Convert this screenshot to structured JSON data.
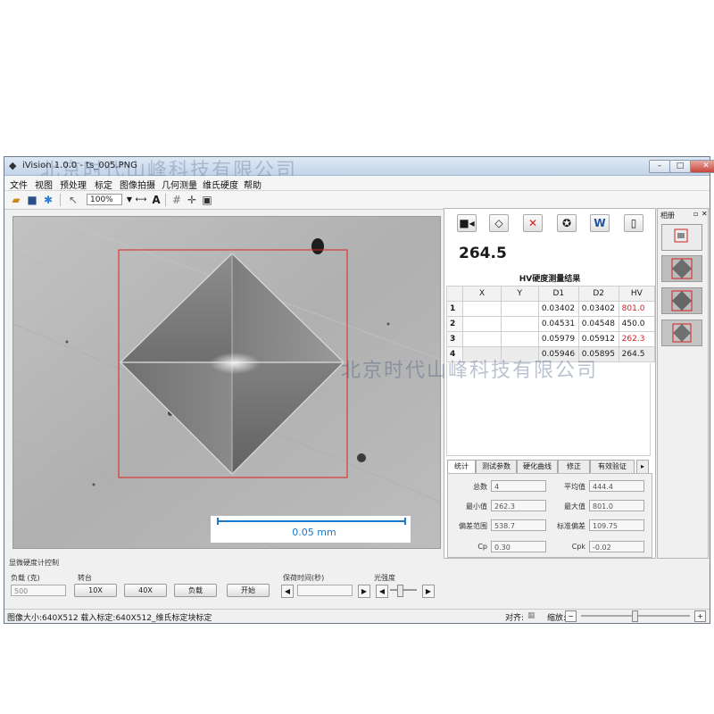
{
  "window": {
    "title": "iVision 1.0.0 - ts_005.PNG"
  },
  "watermark": {
    "text": "北京时代山峰科技有限公司"
  },
  "menu": {
    "items": [
      "文件",
      "视图",
      "预处理",
      "标定",
      "图像拍摄",
      "几何测量",
      "维氏硬度",
      "帮助"
    ]
  },
  "toolbar": {
    "zoom": "100%",
    "text_tool": "A"
  },
  "image": {
    "scale_label": "0.05 mm"
  },
  "results": {
    "current_value": "264.5",
    "table_title": "HV硬度测量结果",
    "columns": [
      "",
      "X",
      "Y",
      "D1",
      "D2",
      "HV"
    ],
    "rows": [
      {
        "n": "1",
        "x": "",
        "y": "",
        "d1": "0.03402",
        "d2": "0.03402",
        "hv": "801.0",
        "hv_red": true
      },
      {
        "n": "2",
        "x": "",
        "y": "",
        "d1": "0.04531",
        "d2": "0.04548",
        "hv": "450.0",
        "hv_red": false
      },
      {
        "n": "3",
        "x": "",
        "y": "",
        "d1": "0.05979",
        "d2": "0.05912",
        "hv": "262.3",
        "hv_red": true
      },
      {
        "n": "4",
        "x": "",
        "y": "",
        "d1": "0.05946",
        "d2": "0.05895",
        "hv": "264.5",
        "hv_red": false
      }
    ]
  },
  "tabs": [
    "统计",
    "测试参数",
    "硬化曲线",
    "修正",
    "有效验证"
  ],
  "stats": {
    "total_label": "总数",
    "total": "4",
    "mean_label": "平均值",
    "mean": "444.4",
    "min_label": "最小值",
    "min": "262.3",
    "max_label": "最大值",
    "max": "801.0",
    "range_label": "偏差范围",
    "range": "538.7",
    "std_label": "标准偏差",
    "std": "109.75",
    "cp_label": "Cp",
    "cp": "0.30",
    "cpk_label": "Cpk",
    "cpk": "-0.02"
  },
  "album": {
    "title": "相册"
  },
  "control": {
    "section_title": "显微硬度计控制",
    "load_label": "负载 (克)",
    "load_value": "500",
    "turret_label": "转台",
    "btn_10x": "10X",
    "btn_40x": "40X",
    "btn_load": "负载",
    "btn_start": "开始",
    "hold_label": "保荷时间(秒)",
    "light_label": "光强度"
  },
  "status": {
    "text": "图像大小:640X512  载入标定:640X512_维氏标定块标定",
    "align_label": "对齐:",
    "zoom_label": "缩放:"
  },
  "colors": {
    "accent_red": "#d42020",
    "scale_blue": "#1c78c8"
  }
}
